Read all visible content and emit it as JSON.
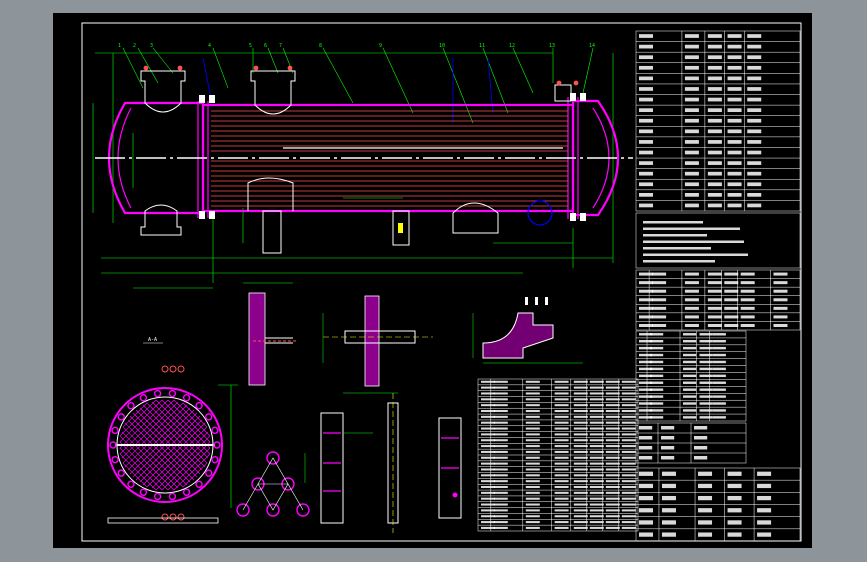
{
  "drawing": {
    "title": "",
    "views": {
      "main": "main-elevation",
      "tubesheet": "tubesheet-end-view",
      "detail_a": "detail-weld",
      "detail_b": "detail-flange",
      "detail_c": "detail-support",
      "tube_pattern": "tube-triangular-pitch"
    },
    "section_a_label": "A-A",
    "pitch_label": "",
    "scale_label": "1:1"
  },
  "tables": {
    "tech_rows": 17,
    "notes_rows": 7,
    "nozzle_rows": 7,
    "parts_rows": 26
  },
  "colors": {
    "background": "#000000",
    "frame": "#ffffff",
    "vessel": "#ff00ff",
    "dimension": "#00ff00",
    "tube": "#ff5050",
    "leader": "#0000ff",
    "center": "#ffffff",
    "highlight": "#ffff00",
    "hatch": "#ff00ff"
  }
}
